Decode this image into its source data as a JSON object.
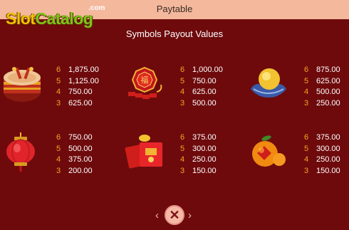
{
  "header": {
    "title": "Paytable"
  },
  "watermark": {
    "brand_slot": "Slot",
    "brand_catalog": "Catalog",
    "brand_com": ".com"
  },
  "subtitle": "Symbols Payout Values",
  "symbols": [
    {
      "icon": "drum-icon",
      "payouts": [
        {
          "count": "6",
          "value": "1,875.00"
        },
        {
          "count": "5",
          "value": "1,125.00"
        },
        {
          "count": "4",
          "value": "750.00"
        },
        {
          "count": "3",
          "value": "625.00"
        }
      ]
    },
    {
      "icon": "firecracker-fu-icon",
      "payouts": [
        {
          "count": "6",
          "value": "1,000.00"
        },
        {
          "count": "5",
          "value": "750.00"
        },
        {
          "count": "4",
          "value": "625.00"
        },
        {
          "count": "3",
          "value": "500.00"
        }
      ]
    },
    {
      "icon": "gold-ingot-icon",
      "payouts": [
        {
          "count": "6",
          "value": "875.00"
        },
        {
          "count": "5",
          "value": "625.00"
        },
        {
          "count": "4",
          "value": "500.00"
        },
        {
          "count": "3",
          "value": "250.00"
        }
      ]
    },
    {
      "icon": "red-lantern-icon",
      "payouts": [
        {
          "count": "6",
          "value": "750.00"
        },
        {
          "count": "5",
          "value": "500.00"
        },
        {
          "count": "4",
          "value": "375.00"
        },
        {
          "count": "3",
          "value": "200.00"
        }
      ]
    },
    {
      "icon": "red-envelope-icon",
      "payouts": [
        {
          "count": "6",
          "value": "375.00"
        },
        {
          "count": "5",
          "value": "300.00"
        },
        {
          "count": "4",
          "value": "250.00"
        },
        {
          "count": "3",
          "value": "150.00"
        }
      ]
    },
    {
      "icon": "orange-icon",
      "payouts": [
        {
          "count": "6",
          "value": "375.00"
        },
        {
          "count": "5",
          "value": "300.00"
        },
        {
          "count": "4",
          "value": "250.00"
        },
        {
          "count": "3",
          "value": "150.00"
        }
      ]
    }
  ],
  "nav": {
    "prev": "‹",
    "close": "✕",
    "next": "›"
  },
  "colors": {
    "background": "#6e0a0c",
    "topbar": "#f4b89d",
    "count": "#f5a623",
    "value": "#ffffff"
  }
}
